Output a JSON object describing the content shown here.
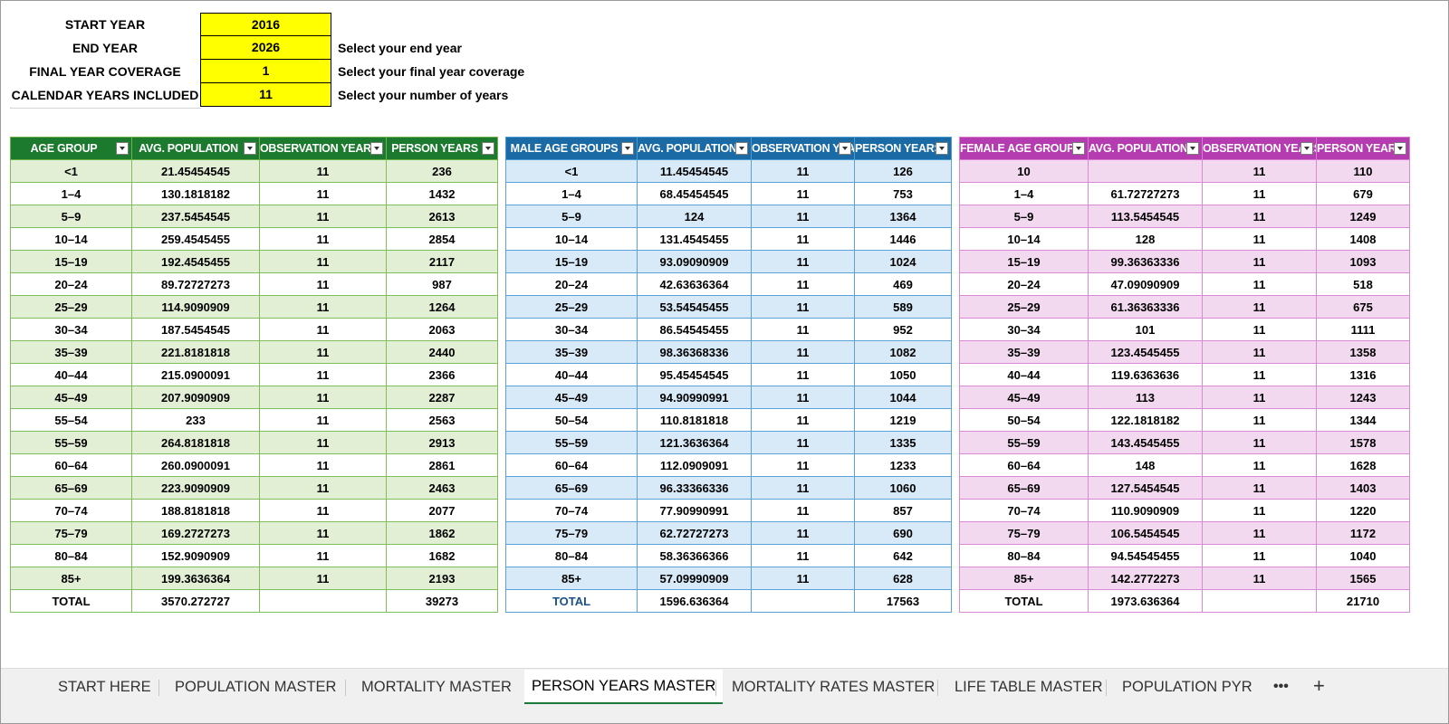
{
  "params": [
    {
      "label": "START YEAR",
      "value": "2016",
      "hint": ""
    },
    {
      "label": "END YEAR",
      "value": "2026",
      "hint": "Select your end year"
    },
    {
      "label": "FINAL YEAR COVERAGE",
      "value": "1",
      "hint": "Select your final year coverage"
    },
    {
      "label": "CALENDAR YEARS INCLUDED",
      "value": "11",
      "hint": "Select your number of years"
    }
  ],
  "colors": {
    "param_fill": "#ffff00",
    "green_header": "#1c7a2e",
    "blue_header": "#1a6aa6",
    "pink_header": "#b53bb0",
    "active_tab_underline": "#1b7a3a"
  },
  "tables": {
    "overall": {
      "headers": [
        "AGE GROUP",
        "AVG. POPULATION",
        "OBSERVATION YEARS",
        "PERSON YEARS"
      ],
      "rows": [
        [
          "<1",
          "21.45454545",
          "11",
          "236"
        ],
        [
          "1–4",
          "130.1818182",
          "11",
          "1432"
        ],
        [
          "5–9",
          "237.5454545",
          "11",
          "2613"
        ],
        [
          "10–14",
          "259.4545455",
          "11",
          "2854"
        ],
        [
          "15–19",
          "192.4545455",
          "11",
          "2117"
        ],
        [
          "20–24",
          "89.72727273",
          "11",
          "987"
        ],
        [
          "25–29",
          "114.9090909",
          "11",
          "1264"
        ],
        [
          "30–34",
          "187.5454545",
          "11",
          "2063"
        ],
        [
          "35–39",
          "221.8181818",
          "11",
          "2440"
        ],
        [
          "40–44",
          "215.0900091",
          "11",
          "2366"
        ],
        [
          "45–49",
          "207.9090909",
          "11",
          "2287"
        ],
        [
          "55–54",
          "233",
          "11",
          "2563"
        ],
        [
          "55–59",
          "264.8181818",
          "11",
          "2913"
        ],
        [
          "60–64",
          "260.0900091",
          "11",
          "2861"
        ],
        [
          "65–69",
          "223.9090909",
          "11",
          "2463"
        ],
        [
          "70–74",
          "188.8181818",
          "11",
          "2077"
        ],
        [
          "75–79",
          "169.2727273",
          "11",
          "1862"
        ],
        [
          "80–84",
          "152.9090909",
          "11",
          "1682"
        ],
        [
          "85+",
          "199.3636364",
          "11",
          "2193"
        ]
      ],
      "total": [
        "TOTAL",
        "3570.272727",
        "",
        "39273"
      ]
    },
    "male": {
      "headers": [
        "MALE AGE GROUPS",
        "AVG. POPULATION",
        "OBSERVATION YEARS",
        "PERSON YEARS"
      ],
      "rows": [
        [
          "<1",
          "11.45454545",
          "11",
          "126"
        ],
        [
          "1–4",
          "68.45454545",
          "11",
          "753"
        ],
        [
          "5–9",
          "124",
          "11",
          "1364"
        ],
        [
          "10–14",
          "131.4545455",
          "11",
          "1446"
        ],
        [
          "15–19",
          "93.09090909",
          "11",
          "1024"
        ],
        [
          "20–24",
          "42.63636364",
          "11",
          "469"
        ],
        [
          "25–29",
          "53.54545455",
          "11",
          "589"
        ],
        [
          "30–34",
          "86.54545455",
          "11",
          "952"
        ],
        [
          "35–39",
          "98.36368336",
          "11",
          "1082"
        ],
        [
          "40–44",
          "95.45454545",
          "11",
          "1050"
        ],
        [
          "45–49",
          "94.90990991",
          "11",
          "1044"
        ],
        [
          "50–54",
          "110.8181818",
          "11",
          "1219"
        ],
        [
          "55–59",
          "121.3636364",
          "11",
          "1335"
        ],
        [
          "60–64",
          "112.0909091",
          "11",
          "1233"
        ],
        [
          "65–69",
          "96.33366336",
          "11",
          "1060"
        ],
        [
          "70–74",
          "77.90990991",
          "11",
          "857"
        ],
        [
          "75–79",
          "62.72727273",
          "11",
          "690"
        ],
        [
          "80–84",
          "58.36366366",
          "11",
          "642"
        ],
        [
          "85+",
          "57.09990909",
          "11",
          "628"
        ]
      ],
      "total": [
        "TOTAL",
        "1596.636364",
        "",
        "17563"
      ]
    },
    "female": {
      "headers": [
        "FEMALE AGE GROUPS",
        "AVG. POPULATION",
        "OBSERVATION YEARS",
        "PERSON YEARS"
      ],
      "rows": [
        [
          "10",
          "",
          "11",
          "110"
        ],
        [
          "1–4",
          "61.72727273",
          "11",
          "679"
        ],
        [
          "5–9",
          "113.5454545",
          "11",
          "1249"
        ],
        [
          "10–14",
          "128",
          "11",
          "1408"
        ],
        [
          "15–19",
          "99.36363336",
          "11",
          "1093"
        ],
        [
          "20–24",
          "47.09090909",
          "11",
          "518"
        ],
        [
          "25–29",
          "61.36363336",
          "11",
          "675"
        ],
        [
          "30–34",
          "101",
          "11",
          "1111"
        ],
        [
          "35–39",
          "123.4545455",
          "11",
          "1358"
        ],
        [
          "40–44",
          "119.6363636",
          "11",
          "1316"
        ],
        [
          "45–49",
          "113",
          "11",
          "1243"
        ],
        [
          "50–54",
          "122.1818182",
          "11",
          "1344"
        ],
        [
          "55–59",
          "143.4545455",
          "11",
          "1578"
        ],
        [
          "60–64",
          "148",
          "11",
          "1628"
        ],
        [
          "65–69",
          "127.5454545",
          "11",
          "1403"
        ],
        [
          "70–74",
          "110.9090909",
          "11",
          "1220"
        ],
        [
          "75–79",
          "106.5454545",
          "11",
          "1172"
        ],
        [
          "80–84",
          "94.54545455",
          "11",
          "1040"
        ],
        [
          "85+",
          "142.2772273",
          "11",
          "1565"
        ]
      ],
      "total": [
        "TOTAL",
        "1973.636364",
        "",
        "21710"
      ]
    }
  },
  "sheet_tabs": {
    "items": [
      "START HERE",
      "POPULATION MASTER",
      "MORTALITY MASTER",
      "PERSON YEARS MASTER",
      "MORTALITY RATES MASTER",
      "LIFE TABLE MASTER",
      "POPULATION PYR"
    ],
    "active": "PERSON YEARS MASTER",
    "more_label": "•••",
    "add_label": "+"
  }
}
